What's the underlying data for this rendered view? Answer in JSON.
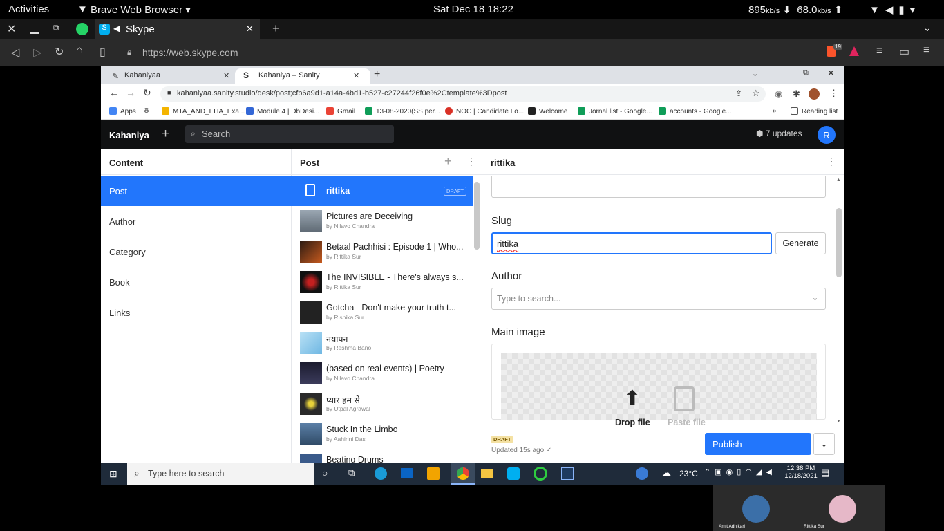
{
  "gnome": {
    "activities": "Activities",
    "app_name": "Brave Web Browser",
    "datetime": "Sat Dec 18  18:22",
    "net_down": "895",
    "net_down_unit": "kb/s",
    "net_up": "68.0",
    "net_up_unit": "kb/s"
  },
  "brave": {
    "tab_title": "Skype",
    "url": "https://web.skype.com",
    "shield_count": "19"
  },
  "chrome": {
    "tabs": [
      {
        "label": "Kahaniyaa"
      },
      {
        "label": "Kahaniya – Sanity"
      }
    ],
    "url": "kahaniyaa.sanity.studio/desk/post;cfb6a9d1-a14a-4bd1-b527-c27244f26f0e%2Ctemplate%3Dpost",
    "bookmarks": [
      "Apps",
      "MTA_AND_EHA_Exa...",
      "Module 4 | DbDesi...",
      "Gmail",
      "13-08-2020(SS per...",
      "NOC | Candidate Lo...",
      "Welcome",
      "Jornal list - Google...",
      "accounts - Google...",
      "Reading list"
    ]
  },
  "sanity": {
    "brand": "Kahaniya",
    "search_placeholder": "Search",
    "updates": "7 updates",
    "avatar": "R"
  },
  "content_pane": {
    "title": "Content",
    "items": [
      "Post",
      "Author",
      "Category",
      "Book",
      "Links"
    ]
  },
  "post_pane": {
    "title": "Post",
    "posts": [
      {
        "title": "rittika",
        "by": "",
        "badge": "DRAFT"
      },
      {
        "title": "Pictures are Deceiving",
        "by": "by Nilavo Chandra"
      },
      {
        "title": "Betaal Pachhisi : Episode 1 | Who...",
        "by": "by Rittika Sur"
      },
      {
        "title": "The INVISIBLE - There's always s...",
        "by": "by Rittika Sur"
      },
      {
        "title": "Gotcha - Don't make your truth t...",
        "by": "by Rishika Sur"
      },
      {
        "title": "नयापन",
        "by": "by Reshma Bano"
      },
      {
        "title": "(based on real events) | Poetry",
        "by": "by Nilavo Chandra"
      },
      {
        "title": "प्यार हम से",
        "by": "by Utpal Agrawal"
      },
      {
        "title": "Stuck In the Limbo",
        "by": "by Aahirini Das"
      },
      {
        "title": "Beating Drums",
        "by": ""
      }
    ]
  },
  "editor": {
    "title": "rittika",
    "slug_label": "Slug",
    "slug_value": "rittika",
    "generate": "Generate",
    "author_label": "Author",
    "author_placeholder": "Type to search...",
    "main_image_label": "Main image",
    "drop_file": "Drop file",
    "paste_file": "Paste file",
    "status_badge": "DRAFT",
    "updated": "Updated 15s ago ✓",
    "publish": "Publish"
  },
  "taskbar": {
    "search_placeholder": "Type here to search",
    "temp": "23°C",
    "time": "12:38 PM",
    "date": "12/18/2021"
  },
  "video": {
    "p1": "Amit Adhikari",
    "p2": "Rittika Sur"
  },
  "colors": {
    "accent": "#2276fc",
    "sanity_nav": "#101112",
    "taskbar": "#1f2b3a"
  }
}
